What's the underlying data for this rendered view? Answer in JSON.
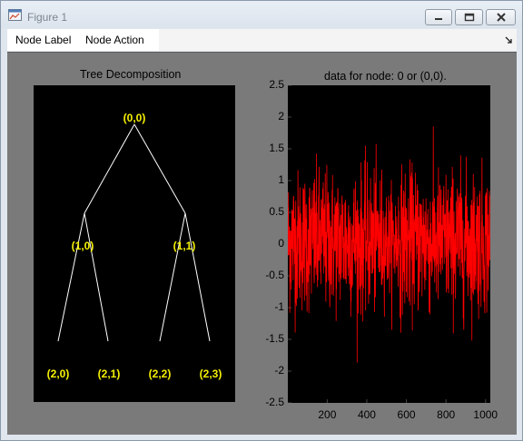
{
  "window": {
    "title": "Figure 1",
    "controls": [
      "minimize",
      "maximize",
      "close"
    ]
  },
  "menu": {
    "items": [
      "Node Label",
      "Node Action"
    ]
  },
  "tree": {
    "title": "Tree Decomposition",
    "root": "(0,0)",
    "level1": [
      "(1,0)",
      "(1,1)"
    ],
    "level2": [
      "(2,0)",
      "(2,1)",
      "(2,2)",
      "(2,3)"
    ],
    "colors": {
      "background": "#000000",
      "edges": "#ffffff",
      "labels": "#f5f000"
    }
  },
  "chart_data": {
    "type": "line",
    "title": "data for node: 0 or (0,0).",
    "xlabel": "",
    "ylabel": "",
    "xlim": [
      1,
      1024
    ],
    "ylim": [
      -2.5,
      2.5
    ],
    "xticks": [
      200,
      400,
      600,
      800,
      1000
    ],
    "yticks": [
      -2.5,
      -2,
      -1.5,
      -1,
      -0.5,
      0,
      0.5,
      1,
      1.5,
      2,
      2.5
    ],
    "xtick_labels": [
      "200",
      "400",
      "600",
      "800",
      "1000"
    ],
    "ytick_labels": [
      "-2.5",
      "-2",
      "-1.5",
      "-1",
      "-0.5",
      "0",
      "0.5",
      "1",
      "1.5",
      "2",
      "2.5"
    ],
    "series": [
      {
        "color": "#ff0000",
        "description": "noisy signal, 1024 samples, centred near 0, range about -2.2 to 2.1",
        "n": 1024,
        "mean": 0.05,
        "std": 0.55,
        "min": -2.2,
        "max": 2.1
      }
    ],
    "background": "#000000",
    "grid": false
  }
}
